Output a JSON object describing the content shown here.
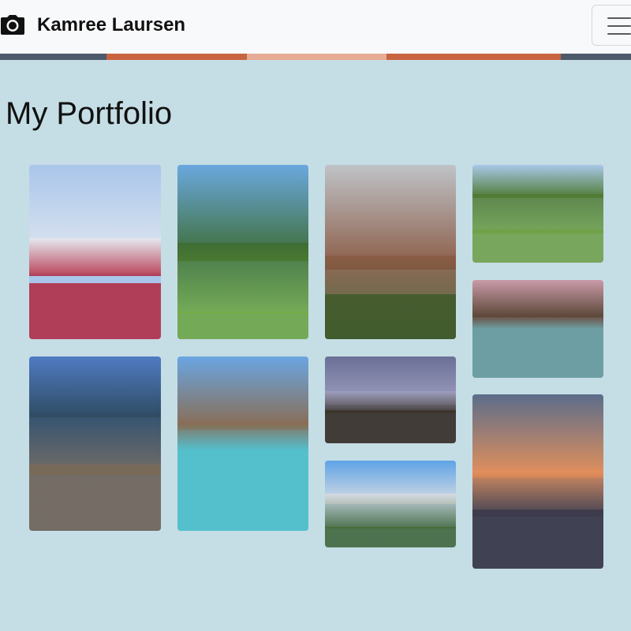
{
  "navbar": {
    "brand_name": "Kamree Laursen",
    "brand_icon": "camera-icon",
    "toggle_icon": "hamburger-menu-icon",
    "background": "#f8f9fa"
  },
  "stripe_colors": [
    "#4d5a6b",
    "#c8643f",
    "#e6ab94",
    "#c8643f",
    "#4d5a6b"
  ],
  "page": {
    "title": "My Portfolio",
    "background": "#c5dde5"
  },
  "gallery": {
    "photos": [
      {
        "name": "photo-white-temple-flowers",
        "colors": [
          "#a9c6ea",
          "#e7eaf0",
          "#b2263e"
        ]
      },
      {
        "name": "photo-palm-trees-lawn",
        "colors": [
          "#6aa8df",
          "#3d6b2f",
          "#76ab3f"
        ]
      },
      {
        "name": "photo-brick-church",
        "colors": [
          "#bfc3c8",
          "#8a5a44",
          "#3e5a2a"
        ]
      },
      {
        "name": "photo-river-valley",
        "colors": [
          "#a8c8e8",
          "#4f7a33",
          "#6fa043"
        ]
      },
      {
        "name": "photo-overwater-bungalows-sunset",
        "colors": [
          "#c99aa8",
          "#5b4737",
          "#5d9fa3"
        ]
      },
      {
        "name": "photo-rocky-coast-waves",
        "colors": [
          "#4f7bc2",
          "#2f4c63",
          "#7a6a55"
        ]
      },
      {
        "name": "photo-overwater-bungalows-lagoon",
        "colors": [
          "#6aa6e2",
          "#8a6a4e",
          "#4fc4c8"
        ]
      },
      {
        "name": "photo-theme-park-night",
        "colors": [
          "#6a6f96",
          "#9fa0c0",
          "#3b3328"
        ]
      },
      {
        "name": "photo-castle-palm-trees",
        "colors": [
          "#5fa3e6",
          "#d9dde3",
          "#4a6a34"
        ]
      },
      {
        "name": "photo-sunset-clouds-water",
        "colors": [
          "#5b6d8a",
          "#e8915a",
          "#3b3a4a"
        ]
      }
    ]
  }
}
